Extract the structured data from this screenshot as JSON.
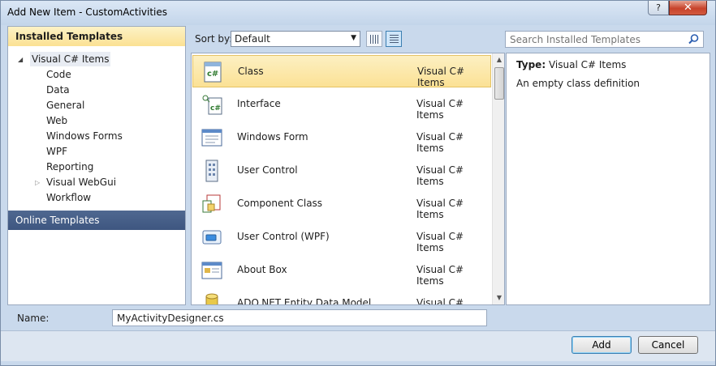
{
  "window": {
    "title": "Add New Item - CustomActivities",
    "help_label": "?",
    "close_label": "✕"
  },
  "sidebar": {
    "installed_header": "Installed Templates",
    "root": "Visual C# Items",
    "items": [
      "Code",
      "Data",
      "General",
      "Web",
      "Windows Forms",
      "WPF",
      "Reporting",
      "Visual WebGui",
      "Workflow"
    ],
    "online_header": "Online Templates"
  },
  "toolbar": {
    "sort_label": "Sort by:",
    "sort_value": "Default"
  },
  "search": {
    "placeholder": "Search Installed Templates"
  },
  "templates": [
    {
      "name": "Class",
      "type": "Visual C# Items",
      "icon": "class-icon"
    },
    {
      "name": "Interface",
      "type": "Visual C# Items",
      "icon": "interface-icon"
    },
    {
      "name": "Windows Form",
      "type": "Visual C# Items",
      "icon": "windows-form-icon"
    },
    {
      "name": "User Control",
      "type": "Visual C# Items",
      "icon": "user-control-icon"
    },
    {
      "name": "Component Class",
      "type": "Visual C# Items",
      "icon": "component-class-icon"
    },
    {
      "name": "User Control (WPF)",
      "type": "Visual C# Items",
      "icon": "wpf-control-icon"
    },
    {
      "name": "About Box",
      "type": "Visual C# Items",
      "icon": "about-box-icon"
    },
    {
      "name": "ADO.NET Entity Data Model",
      "type": "Visual C# Items",
      "icon": "database-icon"
    }
  ],
  "details": {
    "type_label": "Type:",
    "type_value": "Visual C# Items",
    "description": "An empty class definition"
  },
  "name_field": {
    "label": "Name:",
    "value": "MyActivityDesigner.cs"
  },
  "buttons": {
    "add": "Add",
    "cancel": "Cancel"
  }
}
